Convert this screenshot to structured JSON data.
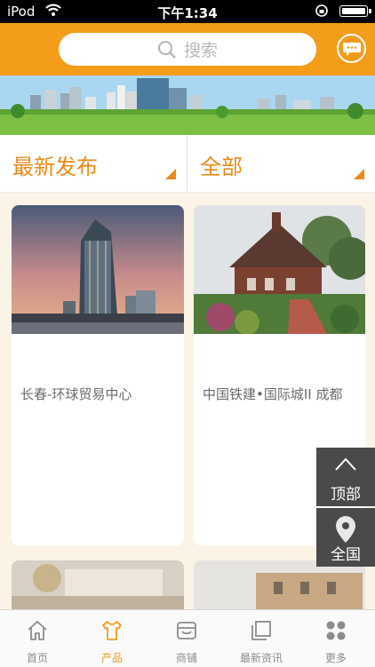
{
  "status_bar": {
    "carrier": "iPod",
    "time": "下午1:34"
  },
  "search": {
    "placeholder": "搜索"
  },
  "filters": [
    {
      "label": "最新发布"
    },
    {
      "label": "全部"
    }
  ],
  "products": [
    {
      "title": "长春-环球贸易中心"
    },
    {
      "title": "中国铁建•国际城II 成都"
    },
    {
      "title": ""
    },
    {
      "title": ""
    }
  ],
  "side_buttons": {
    "top_label": "顶部",
    "all_label": "全国"
  },
  "tabbar": [
    {
      "label": "首页",
      "icon": "home-icon"
    },
    {
      "label": "产品",
      "icon": "shirt-icon",
      "active": true
    },
    {
      "label": "商铺",
      "icon": "store-icon"
    },
    {
      "label": "最新资讯",
      "icon": "news-icon"
    },
    {
      "label": "更多",
      "icon": "more-icon"
    }
  ],
  "colors": {
    "accent": "#f39d1b",
    "filter_text": "#ec8a17",
    "background": "#fbf3e6",
    "side_button": "#4a4a4a"
  }
}
